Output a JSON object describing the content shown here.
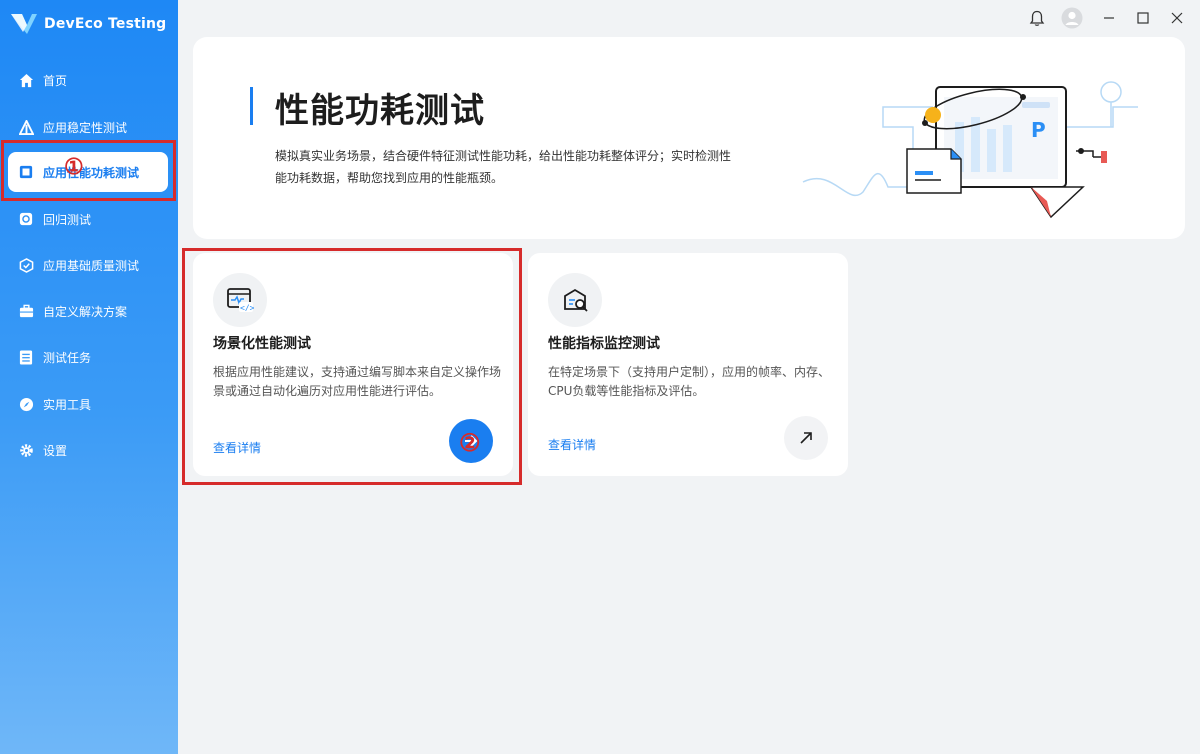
{
  "app": {
    "name": "DevEco Testing"
  },
  "sidebar": {
    "items": [
      {
        "label": "首页",
        "icon": "home-icon"
      },
      {
        "label": "应用稳定性测试",
        "icon": "stability-icon"
      },
      {
        "label": "应用性能功耗测试",
        "icon": "performance-icon",
        "active": true
      },
      {
        "label": "回归测试",
        "icon": "regression-icon"
      },
      {
        "label": "应用基础质量测试",
        "icon": "quality-icon"
      },
      {
        "label": "自定义解决方案",
        "icon": "briefcase-icon"
      },
      {
        "label": "测试任务",
        "icon": "task-list-icon"
      },
      {
        "label": "实用工具",
        "icon": "tools-icon"
      },
      {
        "label": "设置",
        "icon": "gear-icon"
      }
    ]
  },
  "banner": {
    "title": "性能功耗测试",
    "description": "模拟真实业务场景，结合硬件特征测试性能功耗，给出性能功耗整体评分；实时检测性能功耗数据，帮助您找到应用的性能瓶颈。"
  },
  "cards": [
    {
      "title": "场景化性能测试",
      "description": "根据应用性能建议，支持通过编写脚本来自定义操作场景或通过自动化遍历对应用性能进行评估。",
      "link": "查看详情",
      "icon": "code-monitor-icon"
    },
    {
      "title": "性能指标监控测试",
      "description": "在特定场景下（支持用户定制），应用的帧率、内存、CPU负载等性能指标及评估。",
      "link": "查看详情",
      "icon": "monitor-search-icon"
    }
  ],
  "annotations": {
    "step1": "①",
    "step2": "②"
  },
  "colors": {
    "accent": "#1a7ef0",
    "highlight": "#d62b2b"
  }
}
